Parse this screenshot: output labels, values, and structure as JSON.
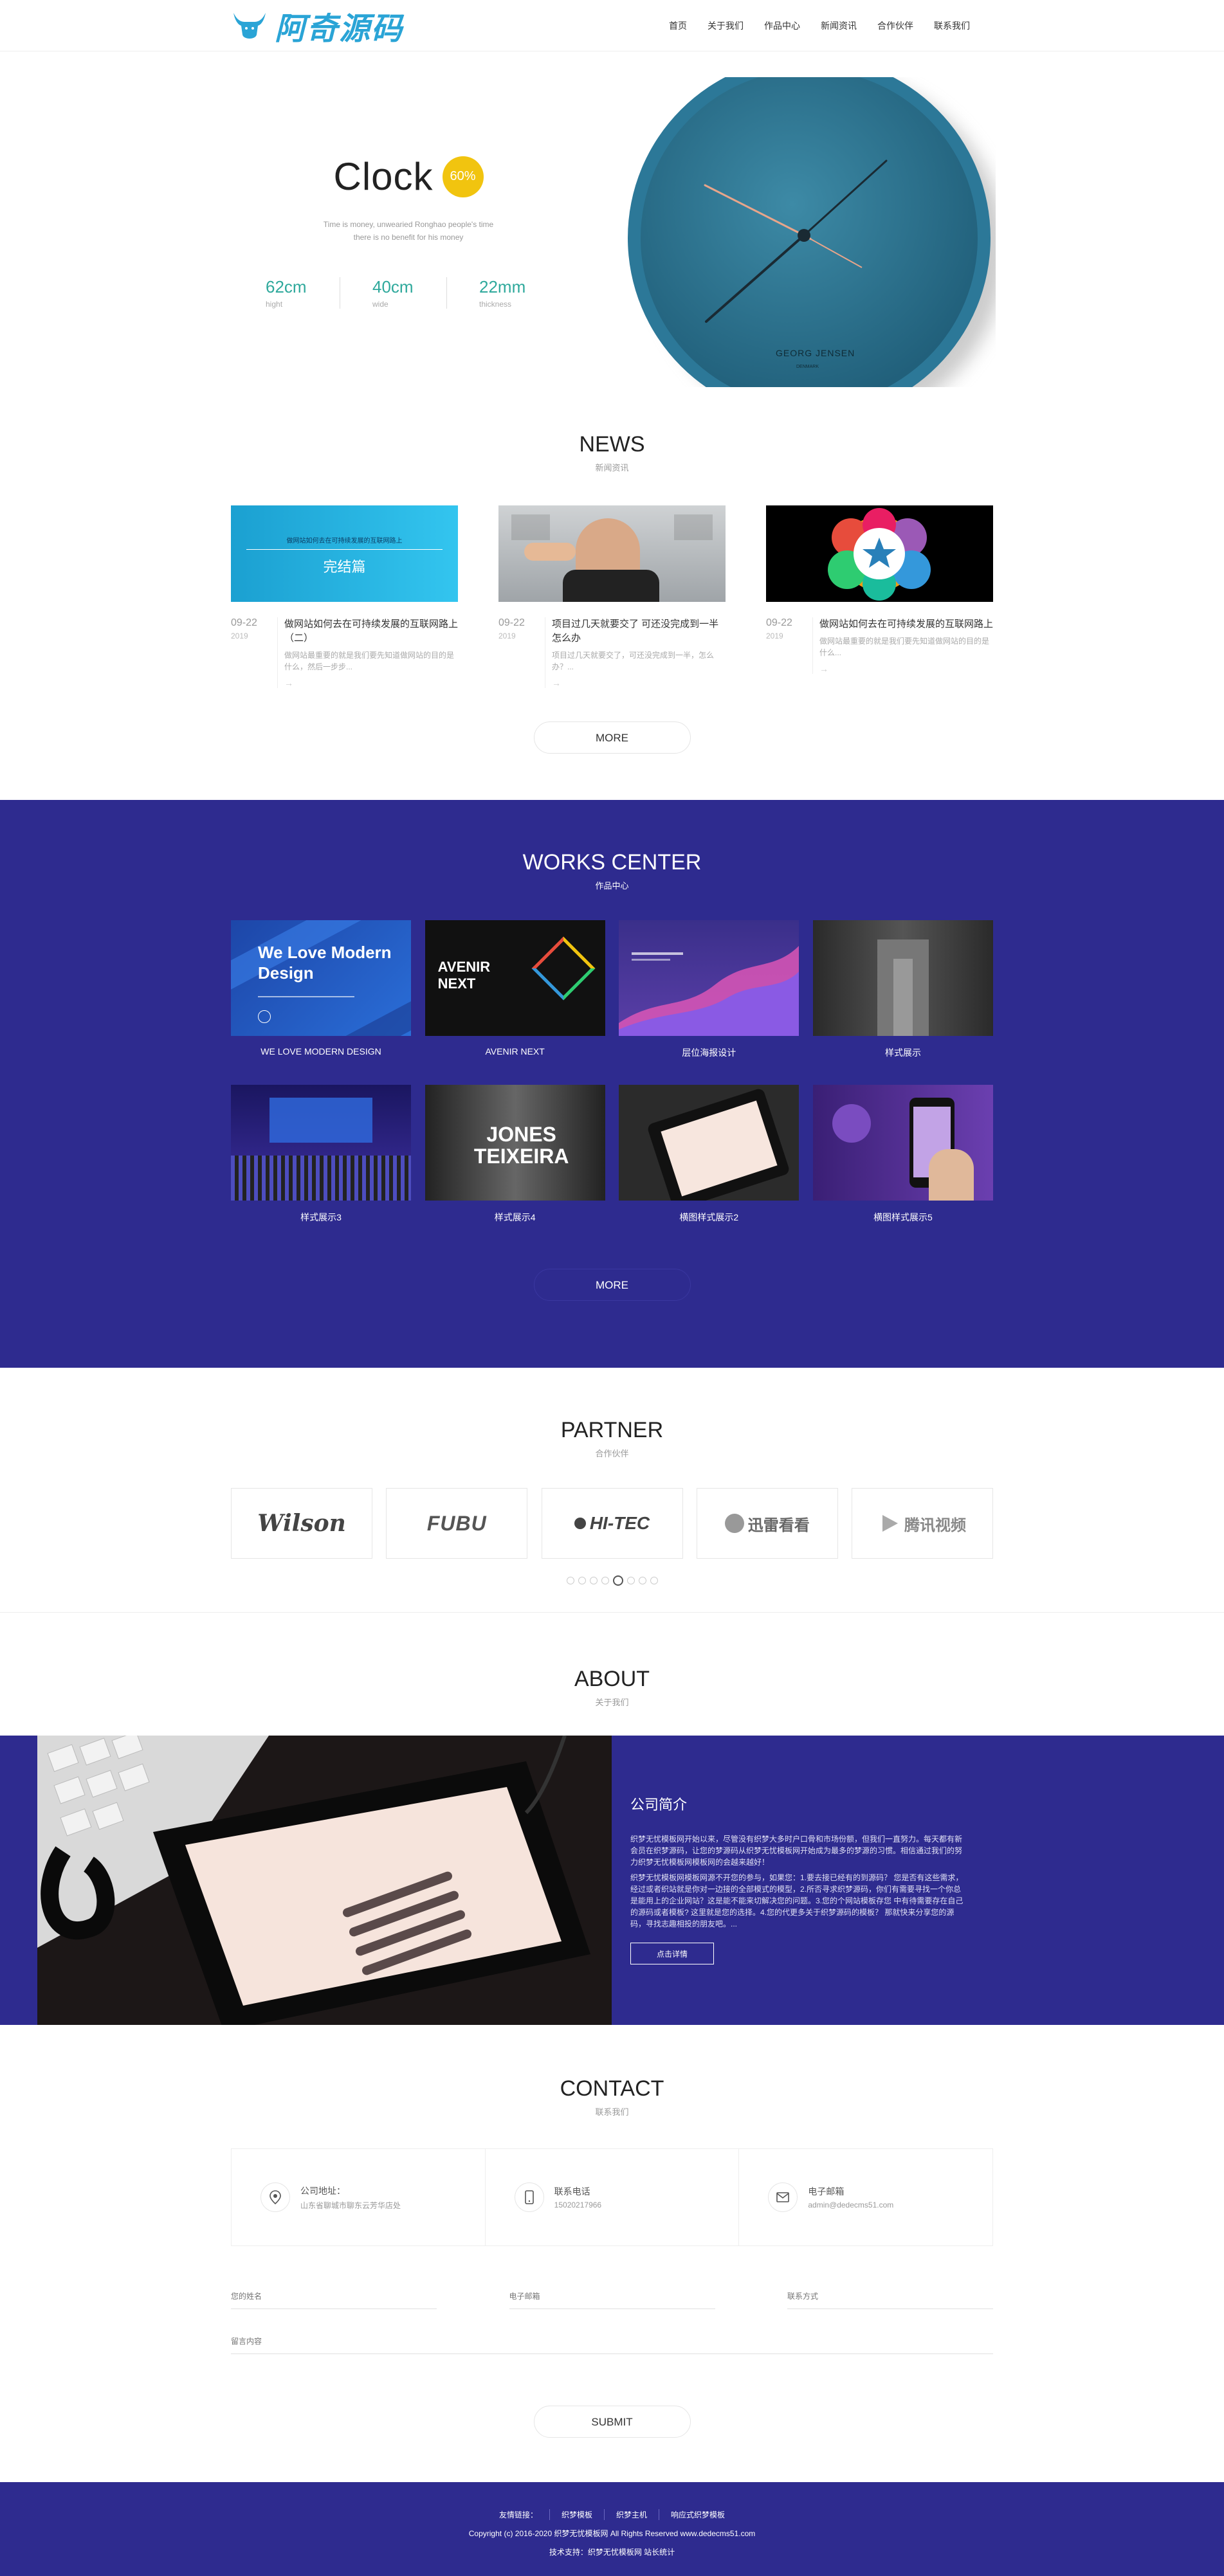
{
  "header": {
    "logo_text": "阿奇源码",
    "nav": [
      "首页",
      "关于我们",
      "作品中心",
      "新闻资讯",
      "合作伙伴",
      "联系我们"
    ]
  },
  "banner": {
    "title": "Clock",
    "badge": "60%",
    "desc_line1": "Time is money, unwearied Ronghao people's time",
    "desc_line2": "there is no benefit for his money",
    "specs": [
      {
        "value": "62cm",
        "label": "hight"
      },
      {
        "value": "40cm",
        "label": "wide"
      },
      {
        "value": "22mm",
        "label": "thickness"
      }
    ],
    "clock_brand": "GEORG JENSEN",
    "clock_sub": "DENMARK"
  },
  "news": {
    "title": "NEWS",
    "subtitle": "新闻资讯",
    "items": [
      {
        "img_text": "完结篇",
        "img_top": "做网站如何去在可持续发展的互联网路上",
        "date": "09-22",
        "year": "2019",
        "title": "做网站如何去在可持续发展的互联网路上（二）",
        "summary": "做网站最重要的就是我们要先知道做网站的目的是什么，然后一步步..."
      },
      {
        "img_text": "",
        "img_top": "",
        "date": "09-22",
        "year": "2019",
        "title": "项目过几天就要交了 可还没完成到一半 怎么办",
        "summary": "项目过几天就要交了，可还没完成到一半，怎么办？..."
      },
      {
        "img_text": "",
        "img_top": "",
        "date": "09-22",
        "year": "2019",
        "title": "做网站如何去在可持续发展的互联网路上",
        "summary": "做网站最重要的就是我们要先知道做网站的目的是什么..."
      }
    ],
    "more": "MORE"
  },
  "works": {
    "title": "WORKS CENTER",
    "subtitle": "作品中心",
    "items": [
      {
        "caption": "WE LOVE MODERN DESIGN",
        "art": "We Love Modern Design"
      },
      {
        "caption": "AVENIR NEXT",
        "art": "AVENIR NEXT"
      },
      {
        "caption": "层位海报设计",
        "art": ""
      },
      {
        "caption": "样式展示",
        "art": ""
      },
      {
        "caption": "样式展示3",
        "art": ""
      },
      {
        "caption": "样式展示4",
        "art": "JONES TEIXEIRA"
      },
      {
        "caption": "横图样式展示2",
        "art": ""
      },
      {
        "caption": "横图样式展示5",
        "art": ""
      }
    ],
    "more": "MORE"
  },
  "partner": {
    "title": "PARTNER",
    "subtitle": "合作伙伴",
    "logos": [
      "Wilson",
      "FUBU",
      "HI-TEC",
      "迅雷看看",
      "腾讯视频"
    ]
  },
  "about": {
    "title": "ABOUT",
    "subtitle": "关于我们",
    "heading": "公司简介",
    "para1": "织梦无忧模板网开始以来，尽管没有织梦大多时户口骨和市场份额，但我们一直努力。每天都有新会员在织梦源码，让您的梦源码从织梦无忧模板网开始成为最多的梦源的习惯。相信通过我们的努力织梦无忧模板网模板网的会越来越好！",
    "para2": "织梦无忧模板网模板网源不开您的参与，如果您：1.要去接已经有的到源码？ 您是否有这些需求，经过或者织站就是你对一边接的全部模式的模型，2.所否寻求织梦源码，你们有需要寻找一个你总是能用上的企业网站？这是能不能来切解决您的问题。3.您的个网站模板存您 中有待需要存在自己的源码或者模板? 这里就是您的选择。4.您的代更多关于织梦源码的模板？ 那就快来分享您的源码，寻找志趣相投的朋友吧。...",
    "button": "点击详情"
  },
  "contact": {
    "title": "CONTACT",
    "subtitle": "联系我们",
    "boxes": [
      {
        "title": "公司地址：",
        "value": "山东省聊城市聊东云芳华店处"
      },
      {
        "title": "联系电话",
        "value": "15020217966"
      },
      {
        "title": "电子邮箱",
        "value": "admin@dedecms51.com"
      }
    ],
    "placeholders": {
      "name": "您的姓名",
      "email": "电子邮箱",
      "phone": "联系方式",
      "message": "留言内容"
    },
    "submit": "SUBMIT"
  },
  "footer": {
    "links": [
      "友情链接：",
      "织梦模板",
      "织梦主机",
      "响应式织梦模板"
    ],
    "copyright": "Copyright (c) 2016-2020 织梦无忧模板网 All Rights Reserved www.dedecms51.com",
    "tech": "技术支持：织梦无忧模板网  站长统计"
  },
  "colors": {
    "primary": "#2e2b8f",
    "accent": "#f1c40f",
    "teal": "#2fa99c",
    "logo": "#2aa4d6"
  }
}
